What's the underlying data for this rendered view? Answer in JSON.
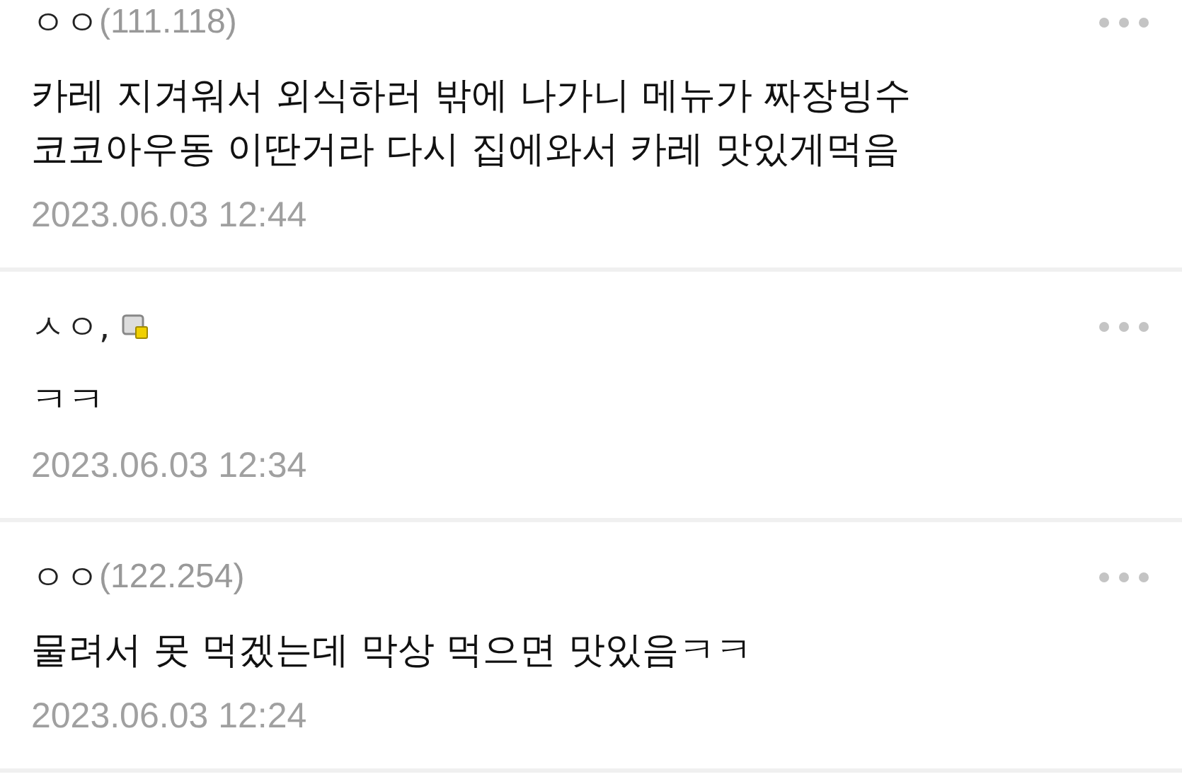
{
  "comments": [
    {
      "author": "ㅇㅇ",
      "ip": "(111.118)",
      "member_icon": false,
      "body": [
        "카레 지겨워서 외식하러 밖에 나가니 메뉴가 짜장빙수",
        "코코아우동 이딴거라 다시 집에와서 카레 맛있게먹음"
      ],
      "date": "2023.06.03 12:44"
    },
    {
      "author": "ㅅㅇ,",
      "member_icon": true,
      "body": [
        "ㅋㅋ"
      ],
      "date": "2023.06.03 12:34"
    },
    {
      "author": "ㅇㅇ",
      "ip": "(122.254)",
      "member_icon": false,
      "body": [
        "물려서 못 먹겠는데 막상 먹으면 맛있음ㅋㅋ"
      ],
      "date": "2023.06.03 12:24"
    }
  ]
}
